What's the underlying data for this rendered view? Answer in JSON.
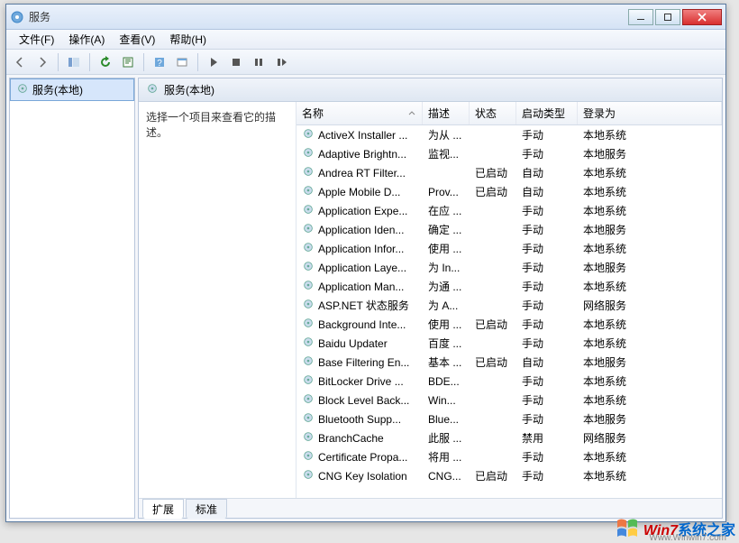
{
  "window": {
    "title": "服务"
  },
  "menubar": [
    "文件(F)",
    "操作(A)",
    "查看(V)",
    "帮助(H)"
  ],
  "tree": {
    "root_label": "服务(本地)"
  },
  "right_header": "服务(本地)",
  "desc_hint": "选择一个项目来查看它的描述。",
  "columns": {
    "name": "名称",
    "desc": "描述",
    "status": "状态",
    "startup": "启动类型",
    "logon": "登录为"
  },
  "tabs": {
    "extended": "扩展",
    "standard": "标准"
  },
  "services": [
    {
      "name": "ActiveX Installer ...",
      "desc": "为从 ...",
      "status": "",
      "startup": "手动",
      "logon": "本地系统"
    },
    {
      "name": "Adaptive Brightn...",
      "desc": "监视...",
      "status": "",
      "startup": "手动",
      "logon": "本地服务"
    },
    {
      "name": "Andrea RT Filter...",
      "desc": "",
      "status": "已启动",
      "startup": "自动",
      "logon": "本地系统"
    },
    {
      "name": "Apple Mobile D...",
      "desc": "Prov...",
      "status": "已启动",
      "startup": "自动",
      "logon": "本地系统"
    },
    {
      "name": "Application Expe...",
      "desc": "在应 ...",
      "status": "",
      "startup": "手动",
      "logon": "本地系统"
    },
    {
      "name": "Application Iden...",
      "desc": "确定 ...",
      "status": "",
      "startup": "手动",
      "logon": "本地服务"
    },
    {
      "name": "Application Infor...",
      "desc": "使用 ...",
      "status": "",
      "startup": "手动",
      "logon": "本地系统"
    },
    {
      "name": "Application Laye...",
      "desc": "为 In...",
      "status": "",
      "startup": "手动",
      "logon": "本地服务"
    },
    {
      "name": "Application Man...",
      "desc": "为通 ...",
      "status": "",
      "startup": "手动",
      "logon": "本地系统"
    },
    {
      "name": "ASP.NET 状态服务",
      "desc": "为 A...",
      "status": "",
      "startup": "手动",
      "logon": "网络服务"
    },
    {
      "name": "Background Inte...",
      "desc": "使用 ...",
      "status": "已启动",
      "startup": "手动",
      "logon": "本地系统"
    },
    {
      "name": "Baidu Updater",
      "desc": "百度 ...",
      "status": "",
      "startup": "手动",
      "logon": "本地系统"
    },
    {
      "name": "Base Filtering En...",
      "desc": "基本 ...",
      "status": "已启动",
      "startup": "自动",
      "logon": "本地服务"
    },
    {
      "name": "BitLocker Drive ...",
      "desc": "BDE...",
      "status": "",
      "startup": "手动",
      "logon": "本地系统"
    },
    {
      "name": "Block Level Back...",
      "desc": "Win...",
      "status": "",
      "startup": "手动",
      "logon": "本地系统"
    },
    {
      "name": "Bluetooth Supp...",
      "desc": "Blue...",
      "status": "",
      "startup": "手动",
      "logon": "本地服务"
    },
    {
      "name": "BranchCache",
      "desc": "此服 ...",
      "status": "",
      "startup": "禁用",
      "logon": "网络服务"
    },
    {
      "name": "Certificate Propa...",
      "desc": "将用 ...",
      "status": "",
      "startup": "手动",
      "logon": "本地系统"
    },
    {
      "name": "CNG Key Isolation",
      "desc": "CNG...",
      "status": "已启动",
      "startup": "手动",
      "logon": "本地系统"
    }
  ],
  "watermark": {
    "brand1": "Win7",
    "brand2": "系统之家",
    "url": "Www.Winwin7.com"
  }
}
